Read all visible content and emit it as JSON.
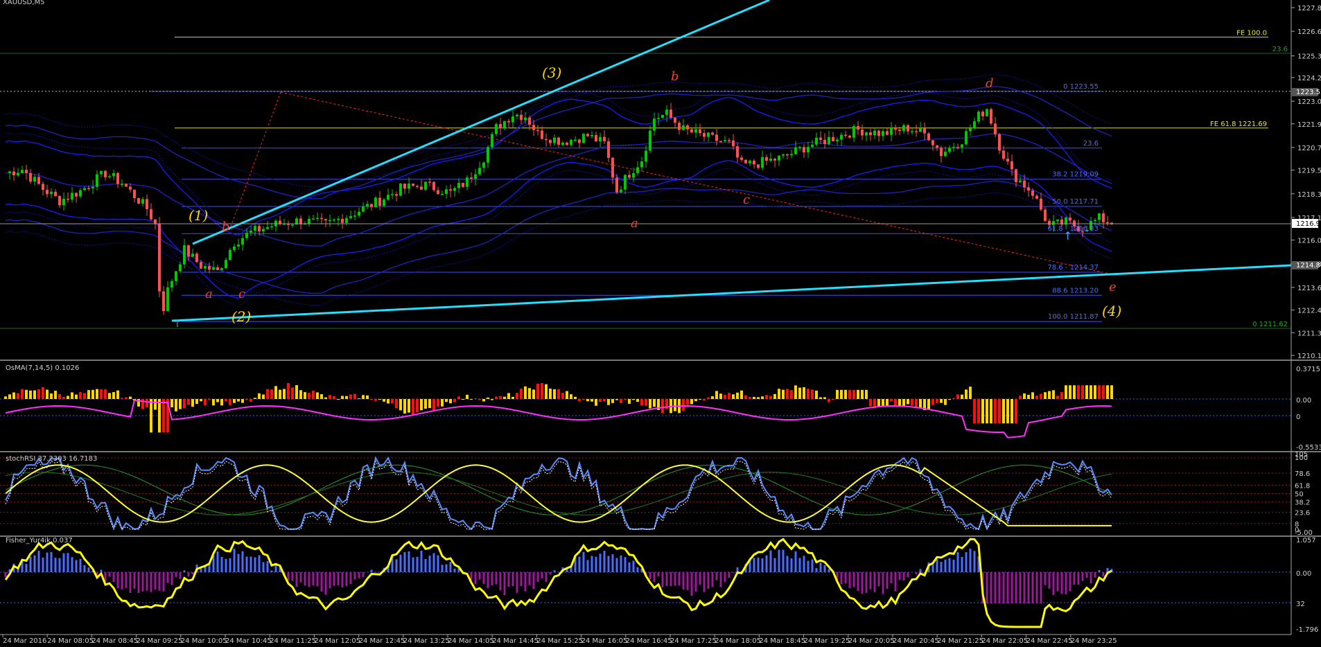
{
  "window": {
    "symbol_title": "XAUUSD,M5"
  },
  "colors": {
    "background": "#000000",
    "bull_candle": "#00c800",
    "bear_candle": "#ff5050",
    "trendline": "#22e0ff",
    "fib_line": "#3850ff",
    "fe_line": "#d8d820",
    "ma_band": "#1a1aff",
    "red_dotted": "#ff2020",
    "osma_pos": "#ffd700",
    "osma_neg": "#ff1010",
    "osma_signal": "#ff30ff",
    "rsi_blue": "#5a8cff",
    "rsi_yellow": "#ffff30",
    "rsi_green": "#2a9a2a",
    "fisher_up": "#4a6cff",
    "fisher_down": "#9a1a9a",
    "fisher_line": "#ffff00",
    "axis_text": "#d0d0d0"
  },
  "main_axis": {
    "ticks": [
      "1227.80",
      "1226.60",
      "1225.35",
      "1224.25",
      "1223.05",
      "1221.90",
      "1220.70",
      "1219.55",
      "1218.35",
      "1217.15",
      "1216.00",
      "1214.80",
      "1213.60",
      "1212.45",
      "1211.30",
      "1210.15"
    ],
    "current_price_label": "1216.90",
    "hidden_label_1": "1223.55",
    "hidden_label_2": "1214.80"
  },
  "fib_labels": {
    "fe100": "FE 100.0",
    "fe618": "FE 61.8 1221.69",
    "fib0": "0 1223.55",
    "fib236": "23.6",
    "fib382": "38.2 1219.09",
    "fib500": "50.0 1217.71",
    "fib618": "61.8 - 1216.33",
    "fib786": "78.6 - 1214.37",
    "fib886": "88.6 1213.20",
    "fib100": "100.0 1211.87",
    "green_top": "23.6",
    "green_bottom": "0 1211.62"
  },
  "wave_labels": {
    "w1": "(1)",
    "w2": "(2)",
    "w3": "(3)",
    "w4": "(4)",
    "a1": "a",
    "b1": "b",
    "c1": "c",
    "a2": "a",
    "b2": "b",
    "c2": "c",
    "d": "d",
    "e": "e"
  },
  "osma": {
    "title": "OsMA(7,14,5) 0.1026",
    "ticks": [
      "0.3715",
      "0.00",
      "0",
      "-0.5533"
    ]
  },
  "rsi": {
    "title": "stochRSI 37.2303 16.7183",
    "ticks": [
      "105",
      "100",
      "78.6",
      "61.8",
      "50",
      "38.2",
      "23.6",
      "8",
      "0",
      "-5.00"
    ]
  },
  "fisher": {
    "title": "Fisher_Yur4ik 0.037",
    "ticks": [
      "1.057",
      "0.00",
      "32",
      "-1.796"
    ]
  },
  "time_axis": [
    "24 Mar 2016",
    "24 Mar 08:05",
    "24 Mar 08:45",
    "24 Mar 09:25",
    "24 Mar 10:05",
    "24 Mar 10:45",
    "24 Mar 11:25",
    "24 Mar 12:05",
    "24 Mar 12:45",
    "24 Mar 13:25",
    "24 Mar 14:05",
    "24 Mar 14:45",
    "24 Mar 15:25",
    "24 Mar 16:05",
    "24 Mar 16:45",
    "24 Mar 17:25",
    "24 Mar 18:05",
    "24 Mar 18:45",
    "24 Mar 19:25",
    "24 Mar 20:05",
    "24 Mar 20:45",
    "24 Mar 21:25",
    "24 Mar 22:05",
    "24 Mar 22:45",
    "24 Mar 23:25"
  ],
  "chart_data": {
    "type": "candlestick",
    "symbol": "XAUUSD,M5",
    "ylim": [
      1209.6,
      1228.4
    ],
    "close_anchors": [
      [
        0,
        1219.4
      ],
      [
        4,
        1219.6
      ],
      [
        9,
        1218.6
      ],
      [
        13,
        1218.0
      ],
      [
        18,
        1218.5
      ],
      [
        24,
        1219.4
      ],
      [
        28,
        1218.9
      ],
      [
        34,
        1217.6
      ],
      [
        36,
        1216.8
      ],
      [
        38,
        1212.9
      ],
      [
        40,
        1214.0
      ],
      [
        43,
        1215.5
      ],
      [
        47,
        1214.7
      ],
      [
        51,
        1214.4
      ],
      [
        55,
        1215.9
      ],
      [
        59,
        1216.4
      ],
      [
        65,
        1216.8
      ],
      [
        71,
        1217.0
      ],
      [
        77,
        1216.8
      ],
      [
        83,
        1217.3
      ],
      [
        89,
        1217.9
      ],
      [
        95,
        1218.6
      ],
      [
        101,
        1218.8
      ],
      [
        107,
        1218.4
      ],
      [
        111,
        1219.0
      ],
      [
        115,
        1220.2
      ],
      [
        118,
        1221.7
      ],
      [
        122,
        1222.4
      ],
      [
        125,
        1222.3
      ],
      [
        128,
        1221.4
      ],
      [
        134,
        1221.0
      ],
      [
        140,
        1221.3
      ],
      [
        144,
        1220.9
      ],
      [
        147,
        1218.5
      ],
      [
        150,
        1219.4
      ],
      [
        153,
        1220.1
      ],
      [
        156,
        1222.2
      ],
      [
        159,
        1222.4
      ],
      [
        163,
        1221.6
      ],
      [
        169,
        1221.2
      ],
      [
        174,
        1220.9
      ],
      [
        177,
        1219.8
      ],
      [
        181,
        1219.9
      ],
      [
        187,
        1220.2
      ],
      [
        193,
        1220.8
      ],
      [
        199,
        1221.2
      ],
      [
        205,
        1221.6
      ],
      [
        211,
        1221.4
      ],
      [
        217,
        1221.7
      ],
      [
        222,
        1221.3
      ],
      [
        225,
        1220.4
      ],
      [
        230,
        1221.1
      ],
      [
        234,
        1222.3
      ],
      [
        236,
        1222.7
      ],
      [
        239,
        1220.8
      ],
      [
        242,
        1219.4
      ],
      [
        247,
        1218.4
      ],
      [
        251,
        1216.7
      ],
      [
        255,
        1216.9
      ],
      [
        259,
        1216.6
      ],
      [
        263,
        1217.1
      ],
      [
        266,
        1216.9
      ]
    ],
    "osma_values_note": "histogram oscillates roughly between -0.5533 and 0.3715",
    "stoch_rsi_range": [
      0,
      100
    ],
    "fisher_range": [
      -1.796,
      1.057
    ],
    "fib_levels": {
      "0": 1223.55,
      "23.6": 1220.67,
      "38.2": 1219.09,
      "50.0": 1217.71,
      "61.8": 1216.33,
      "78.6": 1214.37,
      "88.6": 1213.2,
      "100.0": 1211.87
    },
    "fe_levels": {
      "61.8": 1221.69,
      "100.0": 1226.3
    }
  }
}
